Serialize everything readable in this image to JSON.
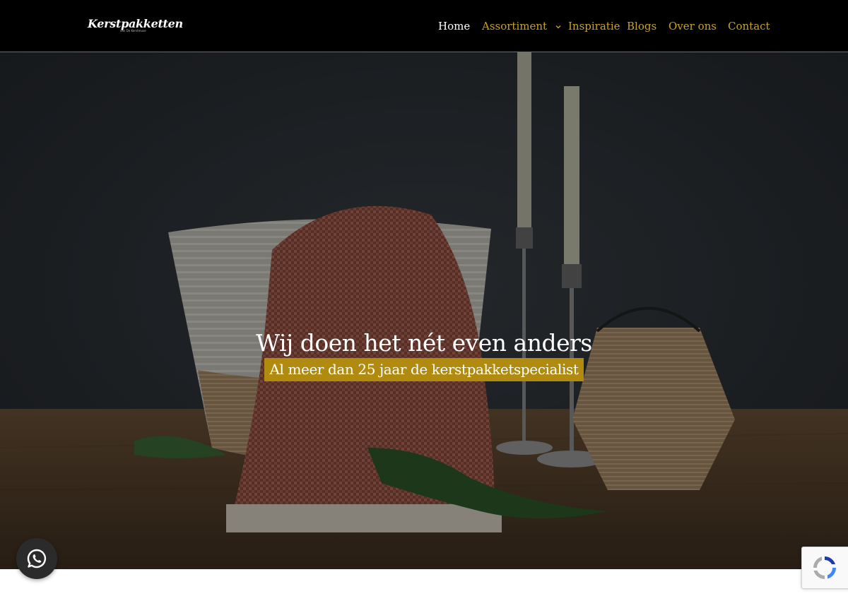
{
  "header": {
    "logo_text": "Kerstpakketten",
    "logo_subtext": "van De Kerstmuse",
    "nav": [
      {
        "label": "Home",
        "active": true
      },
      {
        "label": "Assortiment",
        "has_dropdown": true
      },
      {
        "label": "Inspiratie"
      },
      {
        "label": "Blogs"
      },
      {
        "label": "Over ons"
      },
      {
        "label": "Contact"
      }
    ]
  },
  "hero": {
    "title": "Wij doen het nét even anders",
    "subtitle": "Al meer dan 25 jaar de kerstpakketspecialist"
  },
  "floating": {
    "whatsapp_icon": "whatsapp-icon",
    "recaptcha_icon": "recaptcha-icon"
  },
  "colors": {
    "header_bg": "#000000",
    "nav_link": "#c9a227",
    "nav_active": "#ffffff",
    "accent_gold": "#b08b0f"
  }
}
